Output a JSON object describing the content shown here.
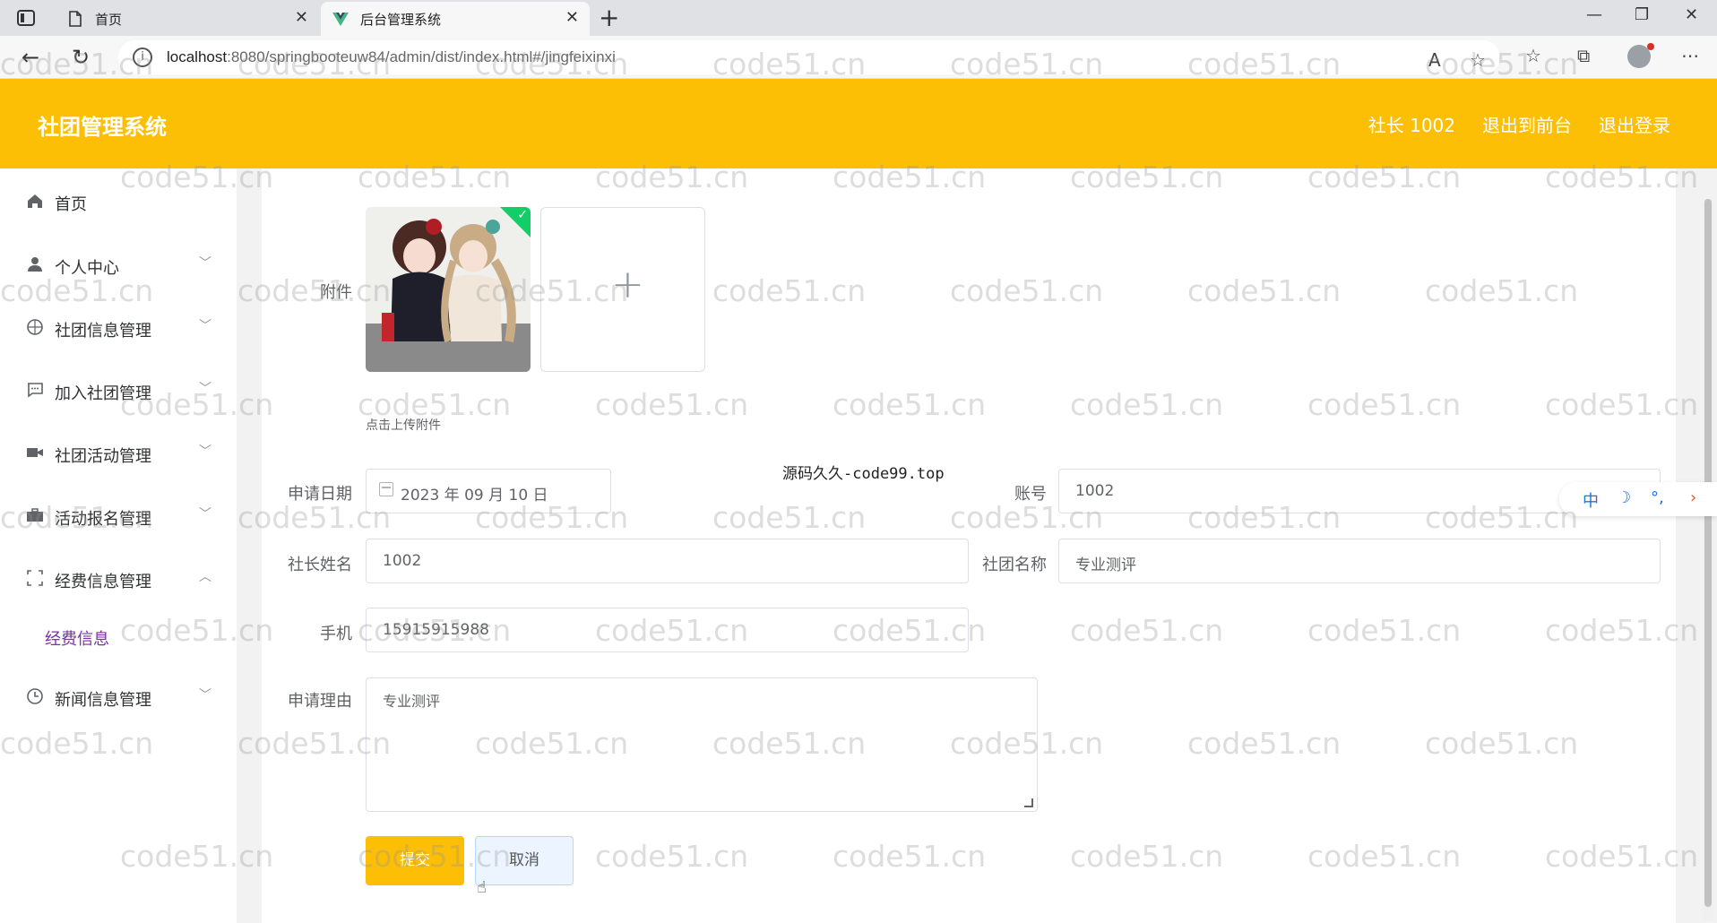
{
  "browser": {
    "tabs": [
      {
        "label": "首页",
        "active": false
      },
      {
        "label": "后台管理系统",
        "active": true
      }
    ],
    "url_host": "localhost",
    "url_rest": ":8080/springbooteuw84/admin/dist/index.html#/jingfeixinxi"
  },
  "header": {
    "title": "社团管理系统",
    "user": "社长 1002",
    "to_front": "退出到前台",
    "logout": "退出登录"
  },
  "sidebar": {
    "items": [
      {
        "label": "首页",
        "icon": "home-icon"
      },
      {
        "label": "个人中心",
        "icon": "user-icon"
      },
      {
        "label": "社团信息管理",
        "icon": "globe-icon"
      },
      {
        "label": "加入社团管理",
        "icon": "chat-icon"
      },
      {
        "label": "社团活动管理",
        "icon": "video-icon"
      },
      {
        "label": "活动报名管理",
        "icon": "suitcase-icon"
      },
      {
        "label": "经费信息管理",
        "icon": "frame-icon"
      },
      {
        "label": "新闻信息管理",
        "icon": "clock-icon"
      }
    ],
    "subitem": "经费信息",
    "accent": "#7b2fa8"
  },
  "form": {
    "attachment_label": "附件",
    "upload_tip": "点击上传附件",
    "date_label": "申请日期",
    "date_value": "2023 年 09 月 10 日",
    "account_label": "账号",
    "account_value": "1002",
    "leader_label": "社长姓名",
    "leader_value": "1002",
    "club_label": "社团名称",
    "club_value": "专业测评",
    "phone_label": "手机",
    "phone_value": "15915915988",
    "reason_label": "申请理由",
    "reason_value": "专业测评",
    "submit": "提交",
    "cancel": "取消"
  },
  "overlay_text": "源码久久-code99.top",
  "ime": {
    "lang": "中",
    "moon": "☽",
    "dots": "°,"
  },
  "watermark": "code51.cn",
  "colors": {
    "brand": "#fcbf06",
    "upload_success": "#13ce66"
  }
}
